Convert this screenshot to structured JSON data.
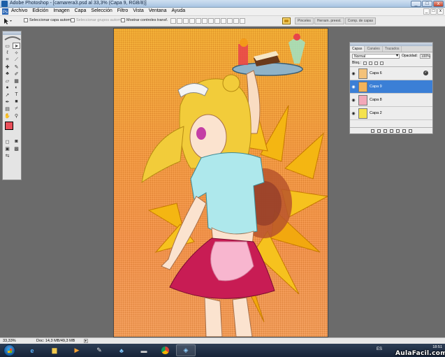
{
  "window": {
    "title": "Adobe Photoshop - [camarera3.psd al 33,3% (Capa 9, RGB/8)]",
    "controls": [
      "_",
      "□",
      "x"
    ]
  },
  "menu": {
    "items": [
      "Archivo",
      "Edición",
      "Imagen",
      "Capa",
      "Selección",
      "Filtro",
      "Vista",
      "Ventana",
      "Ayuda"
    ],
    "doc_controls": [
      "_",
      "□",
      "x"
    ]
  },
  "options": {
    "auto_select_layer": "Seleccionar capa autom.",
    "auto_select_groups": "Seleccionar grupos autom.",
    "show_transform_controls": "Mostrar controles transf.",
    "well_tabs": [
      "Pinceles",
      "Herram. preest.",
      "Comp. de capas"
    ]
  },
  "toolbox": {
    "tools": [
      "marquee-icon",
      "move-icon",
      "lasso-icon",
      "magic-wand-icon",
      "crop-icon",
      "slice-icon",
      "healing-icon",
      "brush-icon",
      "stamp-icon",
      "history-brush-icon",
      "eraser-icon",
      "gradient-icon",
      "blur-icon",
      "dodge-icon",
      "path-select-icon",
      "type-icon",
      "pen-icon",
      "shape-icon",
      "notes-icon",
      "eyedropper-icon",
      "hand-icon",
      "zoom-icon"
    ],
    "foreground_color": "#e94f5a",
    "background_color": "#000000"
  },
  "layers_panel": {
    "tabs": [
      "Capas",
      "Canales",
      "Trazados"
    ],
    "blend_mode": "Normal",
    "opacity_label": "Opacidad:",
    "opacity_value": "100%",
    "lock_label": "Bloq.:",
    "layers": [
      {
        "name": "Capa 6",
        "selected": false,
        "thumb": "#f4c27a",
        "fx": true
      },
      {
        "name": "Capa 9",
        "selected": true,
        "thumb": "#f3b35a",
        "fx": false
      },
      {
        "name": "Capa 8",
        "selected": false,
        "thumb": "#f2a8b8",
        "fx": false
      },
      {
        "name": "Capa 2",
        "selected": false,
        "thumb": "#f5e24d",
        "fx": false
      }
    ]
  },
  "status": {
    "zoom": "33,33%",
    "doc_info": "Doc: 14,3 MB/49,3 MB"
  },
  "taskbar": {
    "apps": [
      "ie-icon",
      "explorer-icon",
      "media-player-icon",
      "paint-icon",
      "network-icon",
      "scanner-icon",
      "chrome-icon",
      "photoshop-icon"
    ],
    "language": "ES",
    "time": "18:51"
  },
  "watermark": "AulaFacil.com",
  "colors": {
    "selection_blue": "#3b7fd6",
    "canvas_orange": "#f7a14a"
  }
}
